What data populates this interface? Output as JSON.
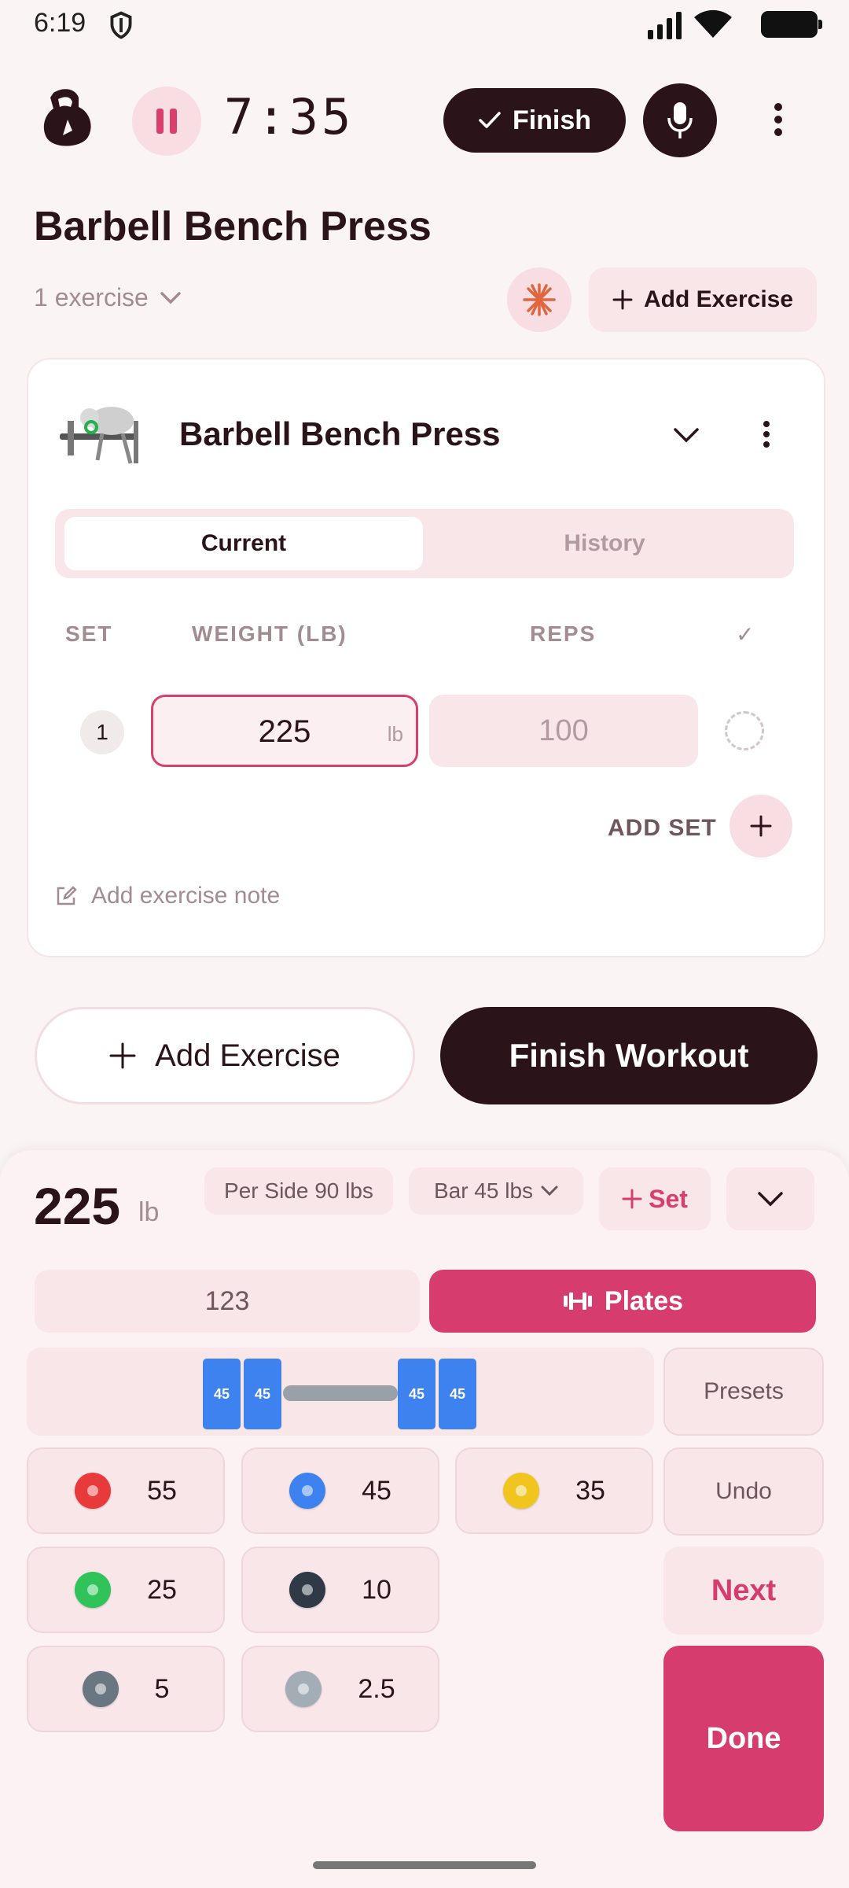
{
  "status_bar": {
    "time": "6:19"
  },
  "header": {
    "timer": "7:35",
    "finish_label": "Finish"
  },
  "workout": {
    "title": "Barbell Bench Press",
    "exercise_count": "1 exercise",
    "add_exercise_label": "Add Exercise"
  },
  "exercise_card": {
    "name": "Barbell Bench Press",
    "tabs": [
      "Current",
      "History"
    ],
    "columns": {
      "set": "SET",
      "weight": "WEIGHT (LB)",
      "reps": "REPS",
      "done": "✓"
    },
    "sets": [
      {
        "set": "1",
        "weight": "225",
        "unit": "lb",
        "reps": "100"
      }
    ],
    "add_set_label": "ADD SET",
    "note_placeholder": "Add exercise note"
  },
  "actions": {
    "add_exercise": "Add Exercise",
    "finish_workout": "Finish Workout"
  },
  "plate_panel": {
    "total_weight": "225",
    "unit": "lb",
    "per_side": "Per Side 90 lbs",
    "bar": "Bar 45 lbs",
    "set_label": "Set",
    "mode_tabs": {
      "numeric": "123",
      "plates": "Plates"
    },
    "loaded_plates": [
      "45",
      "45",
      "45",
      "45"
    ],
    "plates": [
      {
        "weight": "55",
        "color": "#e83a3a"
      },
      {
        "weight": "45",
        "color": "#3d82ee"
      },
      {
        "weight": "35",
        "color": "#f0c51f"
      },
      {
        "weight": "25",
        "color": "#2fc35a"
      },
      {
        "weight": "10",
        "color": "#2f3a46"
      },
      {
        "weight": "5",
        "color": "#6b7683"
      },
      {
        "weight": "2.5",
        "color": "#a3adb6"
      }
    ],
    "side_buttons": {
      "presets": "Presets",
      "undo": "Undo",
      "next": "Next",
      "done": "Done"
    }
  }
}
